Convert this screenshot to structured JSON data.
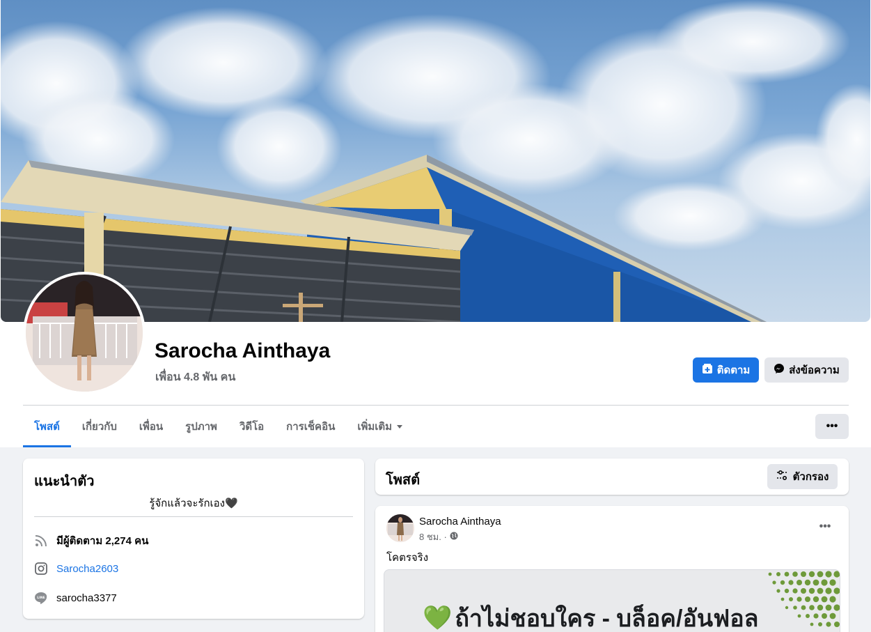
{
  "profile": {
    "name": "Sarocha Ainthaya",
    "friends": "เพื่อน 4.8 พัน คน",
    "follow_label": "ติดตาม",
    "message_label": "ส่งข้อความ"
  },
  "tabs": [
    {
      "label": "โพสต์"
    },
    {
      "label": "เกี่ยวกับ"
    },
    {
      "label": "เพื่อน"
    },
    {
      "label": "รูปภาพ"
    },
    {
      "label": "วิดีโอ"
    },
    {
      "label": "การเช็คอิน"
    },
    {
      "label": "เพิ่มเติม"
    }
  ],
  "intro": {
    "title": "แนะนำตัว",
    "bio": "รู้จักแล้วจะรักเอง🖤",
    "followers": "มีผู้ติดตาม 2,274 คน",
    "instagram": "Sarocha2603",
    "line": "sarocha3377",
    "line_icon_text": "LINE"
  },
  "posts": {
    "title": "โพสต์",
    "filter_label": "ตัวกรอง",
    "item": {
      "author": "Sarocha Ainthaya",
      "time": "8 ชม. ·",
      "text": "โคตรจริง",
      "image_text": "ถ้าไม่ชอบใคร - บล็อค/อันฟอล",
      "image_emoji": "💚"
    }
  },
  "colors": {
    "accent": "#1b74e4",
    "button_gray": "#e4e6eb",
    "page_bg": "#f0f2f5",
    "wall_blue": "#1f5fb5"
  }
}
